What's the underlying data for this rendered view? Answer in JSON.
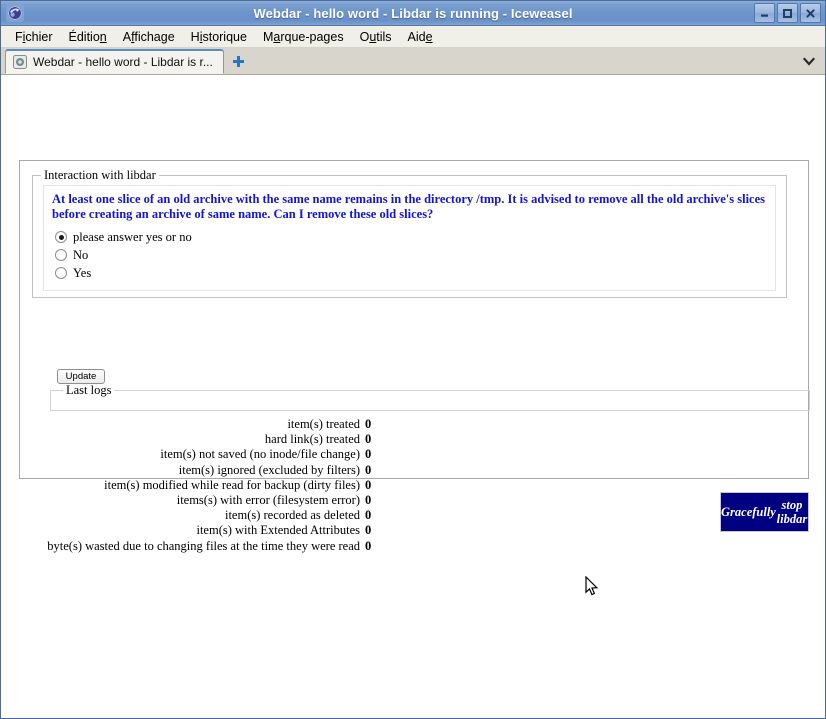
{
  "window": {
    "title": "Webdar - hello word - Libdar is running - Iceweasel",
    "icon": "iceweasel-globe-icon",
    "buttons": [
      {
        "name": "minimize-button",
        "glyph": "minimize-icon"
      },
      {
        "name": "maximize-button",
        "glyph": "maximize-icon"
      },
      {
        "name": "close-button",
        "glyph": "close-icon"
      }
    ]
  },
  "menubar": {
    "items": [
      {
        "pre": "F",
        "key": "i",
        "post": "chier",
        "full": "Fichier"
      },
      {
        "pre": "Éditio",
        "key": "n",
        "post": "",
        "full": "Édition"
      },
      {
        "pre": "A",
        "key": "f",
        "post": "fichage",
        "full": "Affichage"
      },
      {
        "pre": "H",
        "key": "i",
        "post": "storique",
        "full": "Historique"
      },
      {
        "pre": "M",
        "key": "a",
        "post": "rque-pages",
        "full": "Marque-pages"
      },
      {
        "pre": "O",
        "key": "u",
        "post": "tils",
        "full": "Outils"
      },
      {
        "pre": "Aid",
        "key": "e",
        "post": "",
        "full": "Aide"
      }
    ]
  },
  "tabstrip": {
    "tab_label": "Webdar - hello word - Libdar is r...",
    "new_tab_tooltip": "+",
    "tab_list_icon": "chevron-down-icon"
  },
  "page": {
    "outer_legend": "",
    "interaction": {
      "legend": "Interaction with libdar",
      "message": "At least one slice of an old archive with the same name remains in the directory /tmp. It is advised to remove all the old archive's slices before creating an archive of same name. Can I remove these old slices?",
      "message_color": "#1414d2",
      "options": [
        {
          "label": "please answer yes or no",
          "checked": true
        },
        {
          "label": "No",
          "checked": false
        },
        {
          "label": "Yes",
          "checked": false
        }
      ],
      "update_label": "Update"
    },
    "logs": {
      "legend": "Last logs",
      "content": ""
    },
    "stats": [
      {
        "label": "item(s) treated",
        "value": "0"
      },
      {
        "label": "hard link(s) treated",
        "value": "0"
      },
      {
        "label": "item(s) not saved (no inode/file change)",
        "value": "0"
      },
      {
        "label": "item(s) ignored (excluded by filters)",
        "value": "0"
      },
      {
        "label": "item(s) modified while read for backup (dirty files)",
        "value": "0"
      },
      {
        "label": "items(s) with error (filesystem error)",
        "value": "0"
      },
      {
        "label": "item(s) recorded as deleted",
        "value": "0"
      },
      {
        "label": "item(s) with Extended Attributes",
        "value": "0"
      },
      {
        "label": "byte(s) wasted due to changing files at the time they were read",
        "value": "0"
      }
    ],
    "stop_button": {
      "line1": "Gracefully",
      "line2": "stop libdar",
      "background": "#000080",
      "color": "#ffffff"
    }
  }
}
